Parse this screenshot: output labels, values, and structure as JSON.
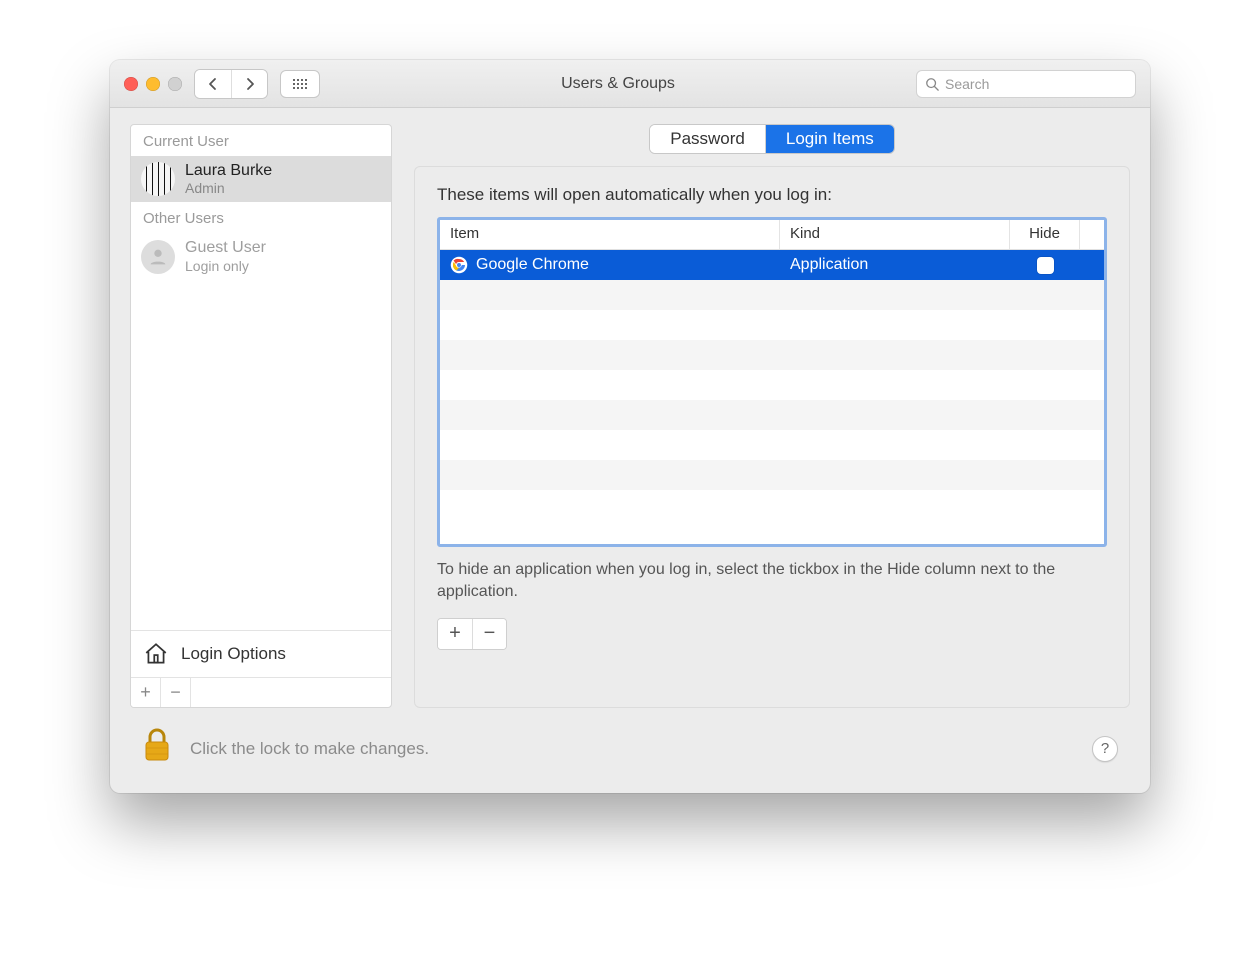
{
  "window": {
    "title": "Users & Groups"
  },
  "search": {
    "placeholder": "Search",
    "value": ""
  },
  "sidebar": {
    "current_heading": "Current User",
    "current_user": {
      "name": "Laura Burke",
      "role": "Admin"
    },
    "other_heading": "Other Users",
    "guest_user": {
      "name": "Guest User",
      "role": "Login only"
    },
    "login_options_label": "Login Options"
  },
  "tabs": {
    "password": "Password",
    "login_items": "Login Items",
    "active": "login_items"
  },
  "login_items": {
    "caption": "These items will open automatically when you log in:",
    "columns": {
      "item": "Item",
      "kind": "Kind",
      "hide": "Hide"
    },
    "rows": [
      {
        "name": "Google Chrome",
        "kind": "Application",
        "hide": false,
        "selected": true
      }
    ],
    "hint": "To hide an application when you log in, select the tickbox in the Hide column next to the application."
  },
  "footer": {
    "lock_message": "Click the lock to make changes."
  }
}
